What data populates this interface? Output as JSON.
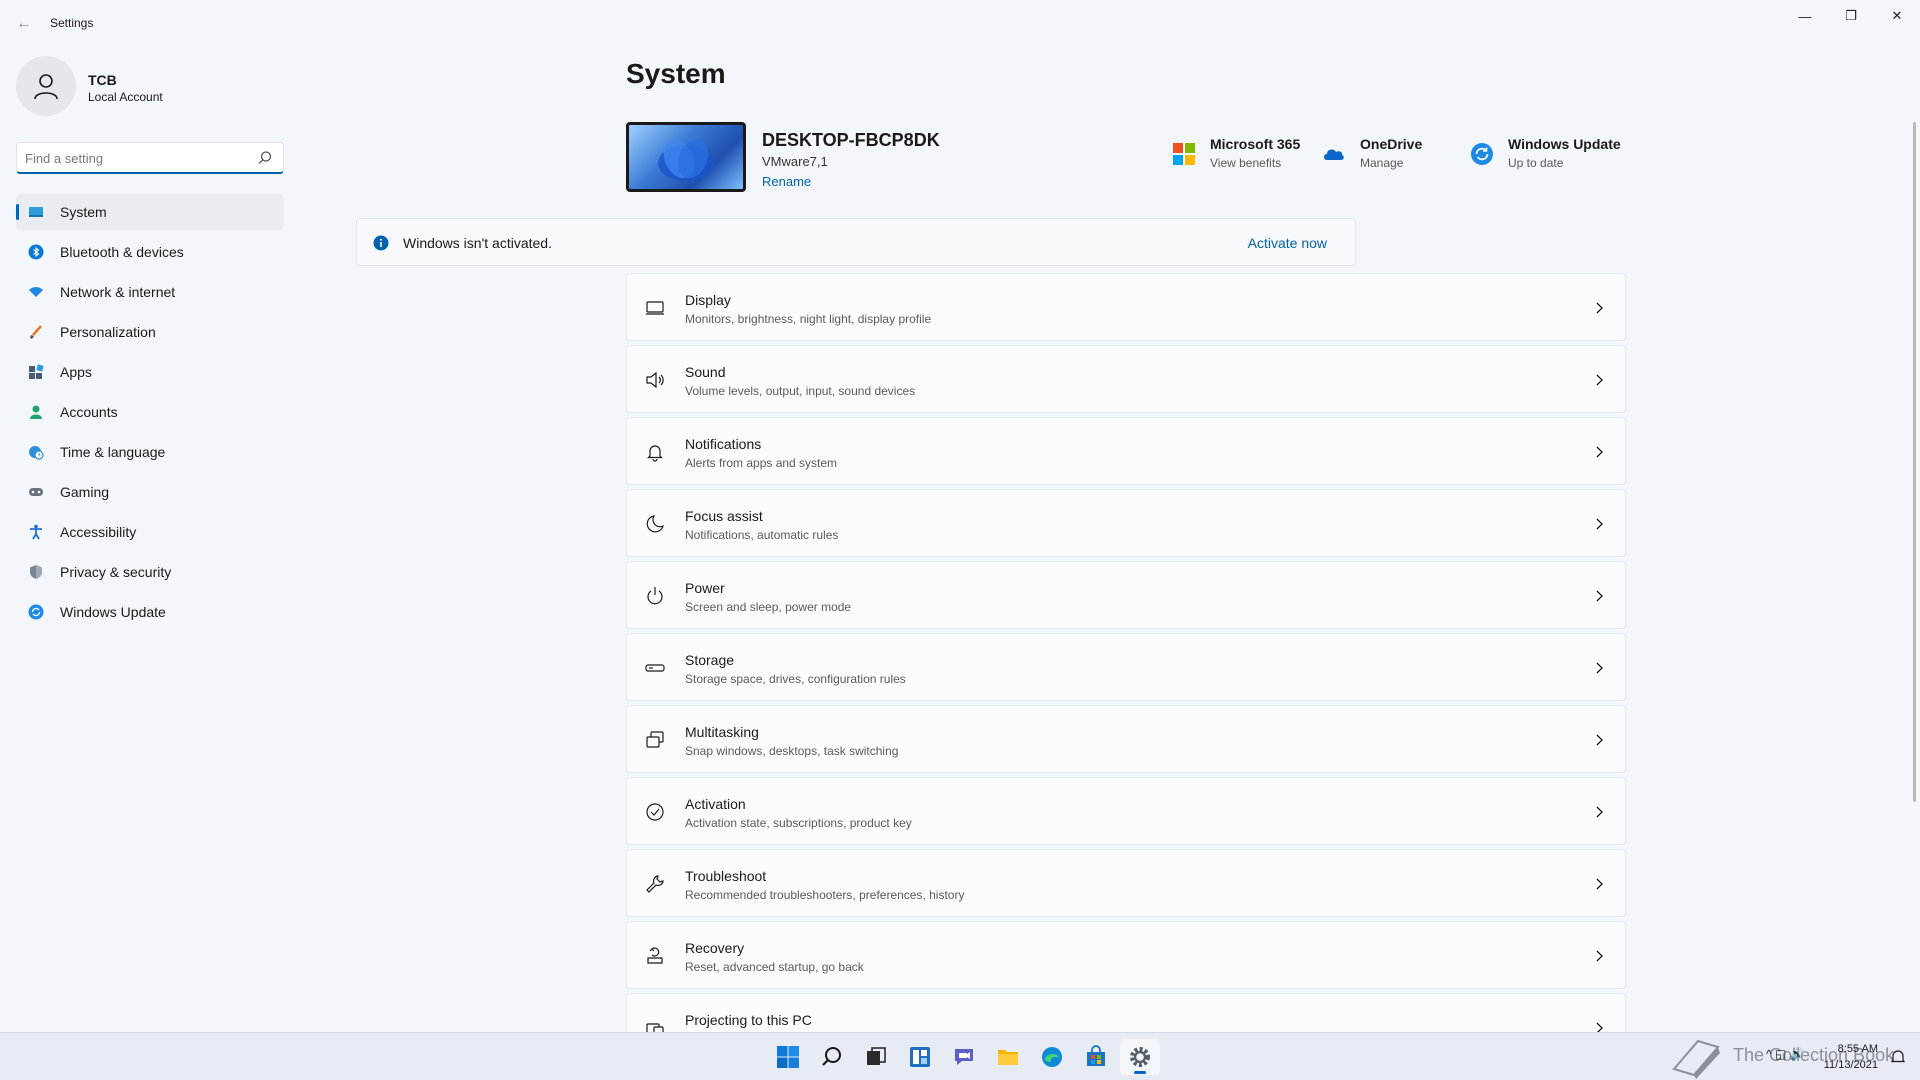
{
  "window": {
    "title": "Settings",
    "back_glyph": "←",
    "minimize_glyph": "—",
    "restore_glyph": "❐",
    "close_glyph": "✕"
  },
  "profile": {
    "name": "TCB",
    "account_type": "Local Account"
  },
  "search": {
    "placeholder": "Find a setting",
    "value": ""
  },
  "nav": {
    "items": [
      {
        "label": "System",
        "icon": "monitor-icon",
        "active": true
      },
      {
        "label": "Bluetooth & devices",
        "icon": "bluetooth-icon"
      },
      {
        "label": "Network & internet",
        "icon": "wifi-icon"
      },
      {
        "label": "Personalization",
        "icon": "brush-icon"
      },
      {
        "label": "Apps",
        "icon": "apps-icon"
      },
      {
        "label": "Accounts",
        "icon": "person-icon"
      },
      {
        "label": "Time & language",
        "icon": "globe-clock-icon"
      },
      {
        "label": "Gaming",
        "icon": "gamepad-icon"
      },
      {
        "label": "Accessibility",
        "icon": "accessibility-icon"
      },
      {
        "label": "Privacy & security",
        "icon": "shield-icon"
      },
      {
        "label": "Windows Update",
        "icon": "update-icon"
      }
    ]
  },
  "main": {
    "title": "System",
    "device": {
      "name": "DESKTOP-FBCP8DK",
      "model": "VMware7,1",
      "rename_label": "Rename"
    },
    "quick_links": [
      {
        "title": "Microsoft 365",
        "subtitle": "View benefits",
        "icon": "microsoft-logo-icon"
      },
      {
        "title": "OneDrive",
        "subtitle": "Manage",
        "icon": "cloud-icon"
      },
      {
        "title": "Windows Update",
        "subtitle": "Up to date",
        "icon": "update-icon"
      }
    ],
    "activation": {
      "message": "Windows isn't activated.",
      "action_label": "Activate now"
    },
    "settings": [
      {
        "title": "Display",
        "subtitle": "Monitors, brightness, night light, display profile",
        "icon": "display-icon"
      },
      {
        "title": "Sound",
        "subtitle": "Volume levels, output, input, sound devices",
        "icon": "speaker-icon"
      },
      {
        "title": "Notifications",
        "subtitle": "Alerts from apps and system",
        "icon": "bell-icon"
      },
      {
        "title": "Focus assist",
        "subtitle": "Notifications, automatic rules",
        "icon": "moon-icon"
      },
      {
        "title": "Power",
        "subtitle": "Screen and sleep, power mode",
        "icon": "power-icon"
      },
      {
        "title": "Storage",
        "subtitle": "Storage space, drives, configuration rules",
        "icon": "storage-icon"
      },
      {
        "title": "Multitasking",
        "subtitle": "Snap windows, desktops, task switching",
        "icon": "multitask-icon"
      },
      {
        "title": "Activation",
        "subtitle": "Activation state, subscriptions, product key",
        "icon": "check-circle-icon"
      },
      {
        "title": "Troubleshoot",
        "subtitle": "Recommended troubleshooters, preferences, history",
        "icon": "wrench-icon"
      },
      {
        "title": "Recovery",
        "subtitle": "Reset, advanced startup, go back",
        "icon": "recovery-icon"
      },
      {
        "title": "Projecting to this PC",
        "subtitle": "",
        "icon": "projecting-icon"
      }
    ]
  },
  "taskbar": {
    "apps": [
      "start-icon",
      "search-icon",
      "task-view-icon",
      "widgets-icon",
      "chat-icon",
      "file-explorer-icon",
      "edge-icon",
      "store-icon",
      "settings-icon"
    ],
    "watermark": "The Collection Book",
    "time": "8:55 AM",
    "date": "11/13/2021",
    "tray_glyphs": "^ ◱ 🔊"
  },
  "colors": {
    "accent": "#0067c0",
    "link": "#0063b1",
    "background": "#f3f6fb"
  }
}
